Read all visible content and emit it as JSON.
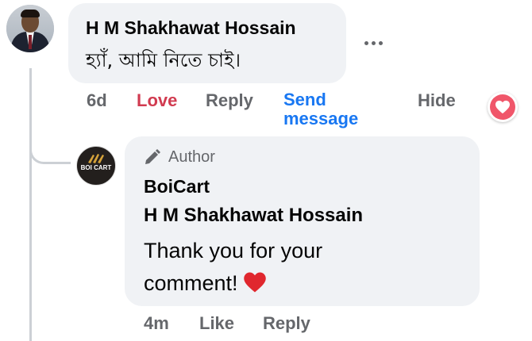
{
  "comment": {
    "author_name": "H M Shakhawat Hossain",
    "text": "হ্যাঁ, আমি নিতে চাই।",
    "time": "6d",
    "love_label": "Love",
    "reply_label": "Reply",
    "send_message_label": "Send message",
    "hide_label": "Hide",
    "reaction_icon": "heart-icon",
    "more_icon": "more-options-icon",
    "love_color": "#d13b50",
    "link_color": "#1877f2"
  },
  "reply": {
    "badge_label": "Author",
    "badge_icon": "pencil-icon",
    "page_name": "BoiCart",
    "avatar_logo_text": "BOI CART",
    "tagged_name": "H M Shakhawat Hossain",
    "text": "Thank you for your comment!",
    "emoji_icon": "red-heart-emoji",
    "time": "4m",
    "like_label": "Like",
    "reply_label": "Reply"
  }
}
